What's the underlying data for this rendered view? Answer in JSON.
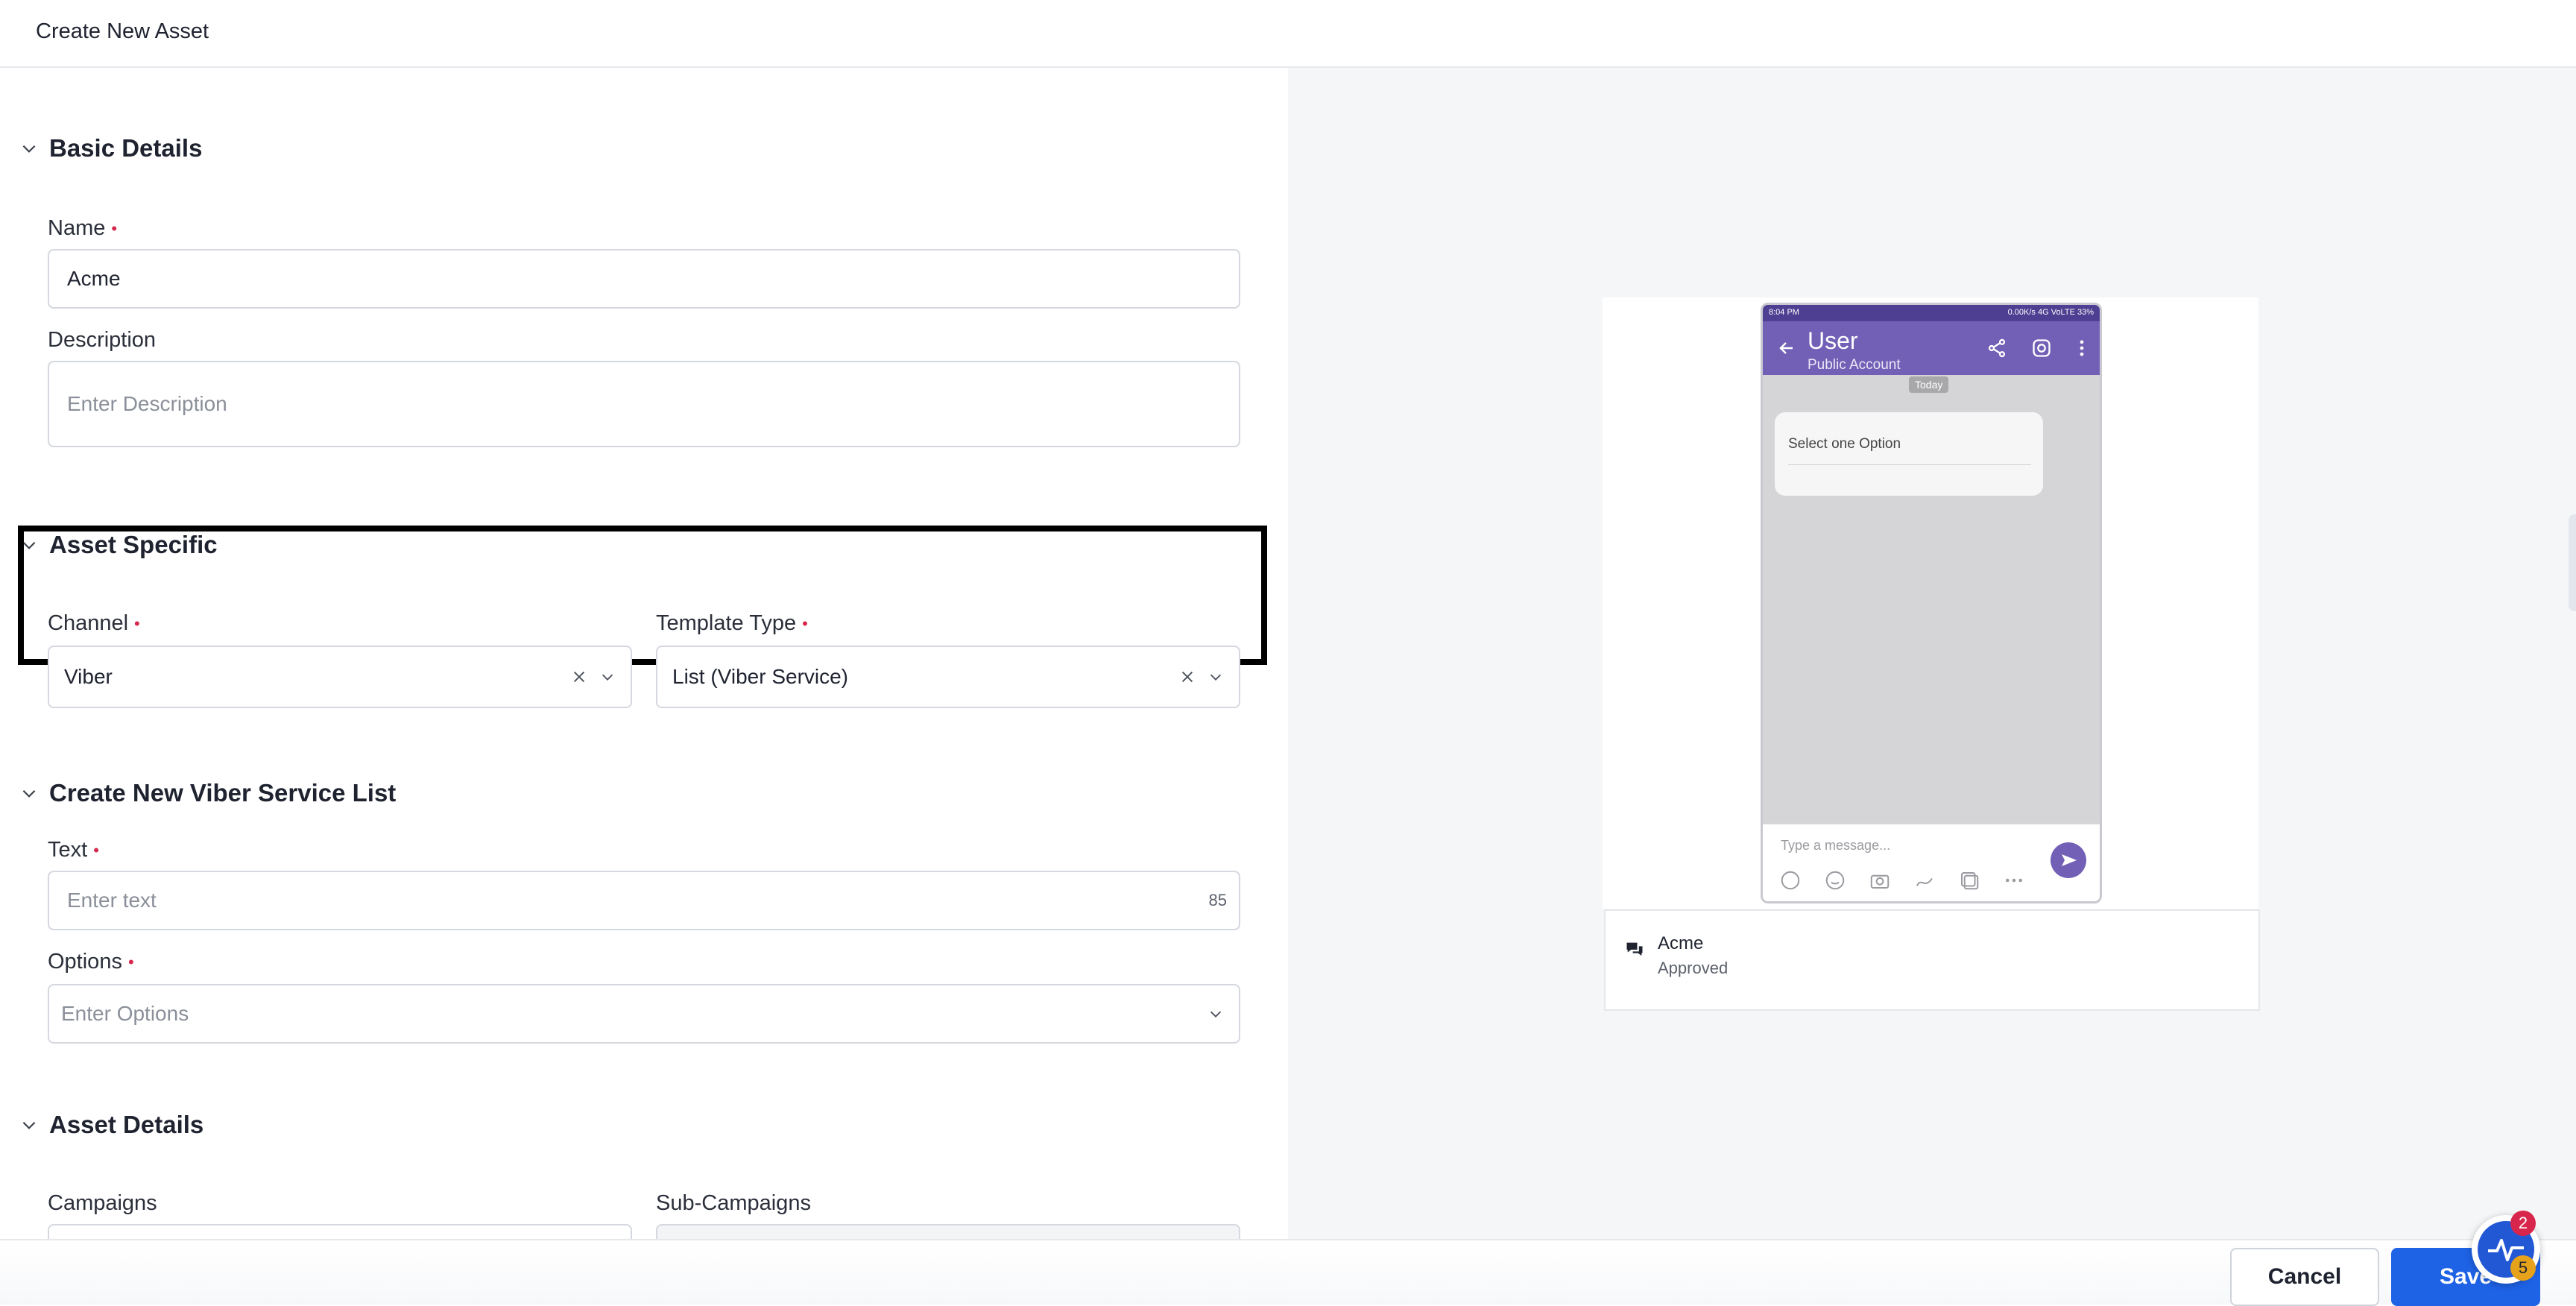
{
  "header": {
    "title": "Create New Asset"
  },
  "sections": {
    "basic": "Basic Details",
    "asset_specific": "Asset Specific",
    "viber_list": "Create New Viber Service List",
    "asset_details": "Asset Details"
  },
  "fields": {
    "name": {
      "label": "Name",
      "value": "Acme"
    },
    "description": {
      "label": "Description",
      "placeholder": "Enter Description"
    },
    "channel": {
      "label": "Channel",
      "value": "Viber"
    },
    "template_type": {
      "label": "Template Type",
      "value": "List (Viber Service)"
    },
    "text": {
      "label": "Text",
      "placeholder": "Enter text",
      "counter": "85"
    },
    "options": {
      "label": "Options",
      "placeholder": "Enter Options"
    },
    "campaigns": {
      "label": "Campaigns"
    },
    "sub_campaigns": {
      "label": "Sub-Campaigns"
    }
  },
  "required_mark": "•",
  "preview": {
    "status_left": "8:04 PM",
    "status_right": "0.00K/s  4G VoLTE  33%",
    "user_name": "User",
    "user_sub": "Public Account",
    "today": "Today",
    "bubble_text": "Select one Option",
    "composer_placeholder": "Type a message..."
  },
  "asset_card": {
    "name": "Acme",
    "status": "Approved"
  },
  "footer": {
    "cancel": "Cancel",
    "save": "Save"
  },
  "notifications": {
    "red_count": "2",
    "yellow_count": "5"
  },
  "colors": {
    "primary": "#1e62e6",
    "viber_purple": "#7160b6",
    "required": "#d8254b"
  }
}
